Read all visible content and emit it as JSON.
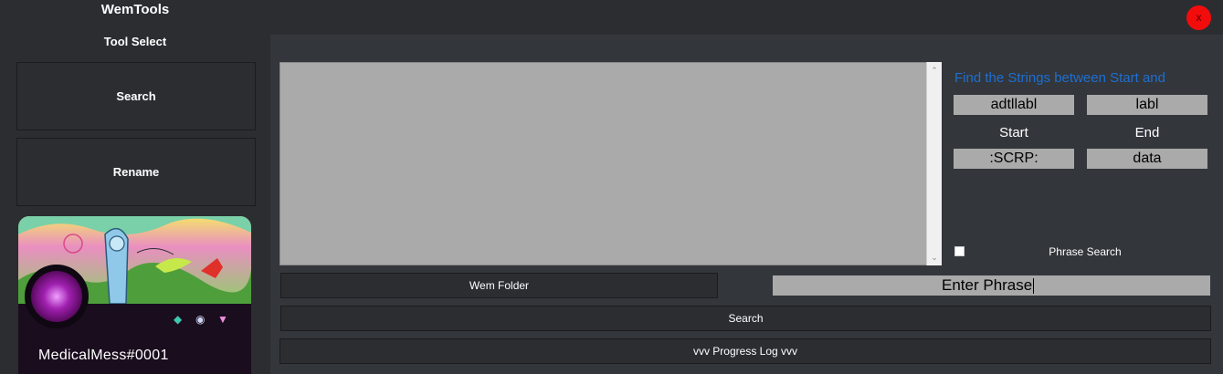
{
  "window": {
    "title": "WemTools",
    "close_label": "x"
  },
  "sidebar": {
    "heading": "Tool Select",
    "tools": [
      {
        "label": "Search"
      },
      {
        "label": "Rename"
      }
    ],
    "profile": {
      "username": "MedicalMess#0001",
      "badges": [
        "hypesquad-icon",
        "nitro-boost-icon",
        "gem-icon"
      ]
    }
  },
  "string_finder": {
    "caption": "Find the Strings between Start and",
    "start_label": "Start",
    "end_label": "End",
    "pairs": [
      {
        "start": "adtllabl",
        "end": "labl"
      },
      {
        "start": ":SCRP:",
        "end": "data"
      }
    ],
    "phrase_search_label": "Phrase Search",
    "phrase_search_checked": false
  },
  "controls": {
    "wem_folder_label": "Wem Folder",
    "phrase_value": "Enter Phrase",
    "search_label": "Search",
    "progress_log_label": "vvv Progress Log vvv"
  },
  "colors": {
    "background": "#2b2d31",
    "panel": "#33363b",
    "field": "#aaaaaa",
    "accent": "#1e6fd1",
    "close": "#f20c0c"
  }
}
